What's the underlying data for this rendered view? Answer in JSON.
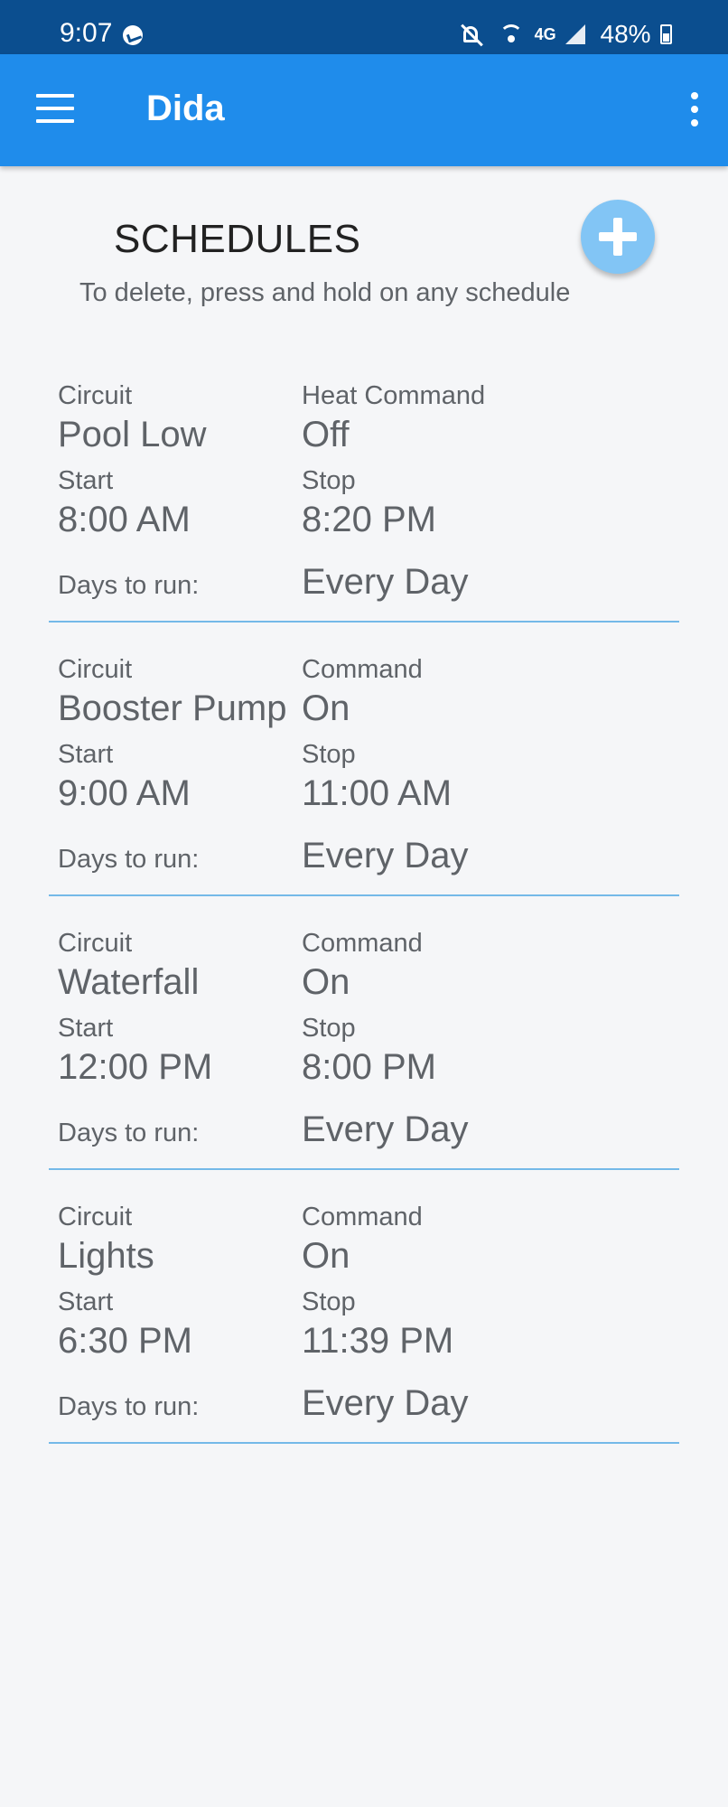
{
  "status_bar": {
    "time": "9:07",
    "network": "4G",
    "battery": "48%"
  },
  "app_bar": {
    "title": "Dida"
  },
  "header": {
    "title": "SCHEDULES",
    "subtitle": "To delete, press and hold on any schedule"
  },
  "labels": {
    "circuit": "Circuit",
    "start": "Start",
    "stop": "Stop",
    "days": "Days to run:"
  },
  "schedules": [
    {
      "circuit": "Pool Low",
      "command_label": "Heat Command",
      "command": "Off",
      "start": "8:00 AM",
      "stop": "8:20 PM",
      "days": "Every Day"
    },
    {
      "circuit": "Booster Pump",
      "command_label": "Command",
      "command": "On",
      "start": "9:00 AM",
      "stop": "11:00 AM",
      "days": "Every Day"
    },
    {
      "circuit": "Waterfall",
      "command_label": "Command",
      "command": "On",
      "start": "12:00 PM",
      "stop": "8:00 PM",
      "days": "Every Day"
    },
    {
      "circuit": "Lights",
      "command_label": "Command",
      "command": "On",
      "start": "6:30 PM",
      "stop": "11:39 PM",
      "days": "Every Day"
    }
  ],
  "colors": {
    "status_bar": "#0b4e8f",
    "app_bar": "#1f8ceb",
    "fab": "#82c5f5",
    "divider": "#74b9e8"
  }
}
